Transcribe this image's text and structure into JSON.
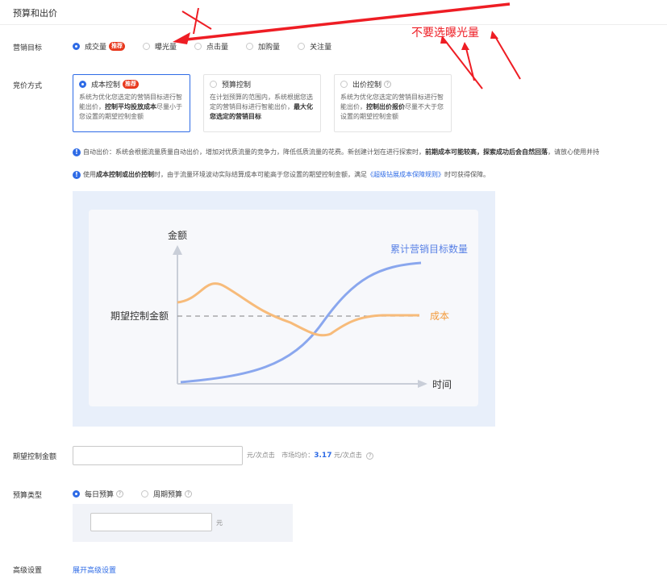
{
  "section_title": "预算和出价",
  "marketing_goal": {
    "label": "营销目标",
    "options": [
      {
        "label": "成交量",
        "badge": "推荐",
        "selected": true
      },
      {
        "label": "曝光量",
        "selected": false
      },
      {
        "label": "点击量",
        "selected": false
      },
      {
        "label": "加购量",
        "selected": false
      },
      {
        "label": "关注量",
        "selected": false
      }
    ]
  },
  "bid_method": {
    "label": "竞价方式",
    "cards": [
      {
        "title": "成本控制",
        "badge": "推荐",
        "selected": true,
        "desc_1": "系统为优化您选定的营销目标进行智能出价，",
        "desc_bold": "控制平均投放成本",
        "desc_2": "尽量小于您设置的期望控制金额"
      },
      {
        "title": "预算控制",
        "selected": false,
        "desc_1": "在计划预算的范围内，系统根据您选定的营销目标进行智能出价，",
        "desc_bold": "最大化您选定的营销目标",
        "desc_2": ""
      },
      {
        "title": "出价控制",
        "selected": false,
        "desc_1": "系统为优化您选定的营销目标进行智能出价，",
        "desc_bold": "控制出价报价",
        "desc_2": "尽量不大于您设置的期望控制金额"
      }
    ]
  },
  "info": {
    "line1_a": "自动出价：系统会根据流量质量自动出价，增加对优质流量的竞争力，降低低质流量的花费。新创建计划在进行探索时，",
    "line1_b": "前期成本可能较高，探索成功后会自然回落",
    "line1_c": "，请放心使用并持",
    "line2_a": "使用",
    "line2_b": "成本控制或出价控制",
    "line2_c": "时，由于流量环境波动实际结算成本可能高于您设置的期望控制金额，满足",
    "line2_link": "《超级钻展成本保障规则》",
    "line2_d": "时可获得保障。"
  },
  "chart": {
    "ylabel": "金额",
    "xlabel": "时间",
    "reference_label": "期望控制金额",
    "series_target": "累计营销目标数量",
    "series_cost": "成本",
    "colors": {
      "target": "#6d92ea",
      "cost": "#f5a64a",
      "reference": "#999999"
    }
  },
  "expected_amount": {
    "label": "期望控制金额",
    "value": "",
    "unit": "元/次点击",
    "market_label": "市场均价：",
    "market_value": "3.17",
    "market_unit": "元/次点击"
  },
  "budget": {
    "label": "预算类型",
    "options": [
      {
        "label": "每日预算",
        "selected": true
      },
      {
        "label": "周期预算",
        "selected": false
      }
    ],
    "value": "",
    "unit": "元"
  },
  "advanced": {
    "label": "高级设置",
    "link": "展开高级设置"
  },
  "annotation": {
    "text": "不要选曝光量",
    "color": "#ee1d24"
  }
}
